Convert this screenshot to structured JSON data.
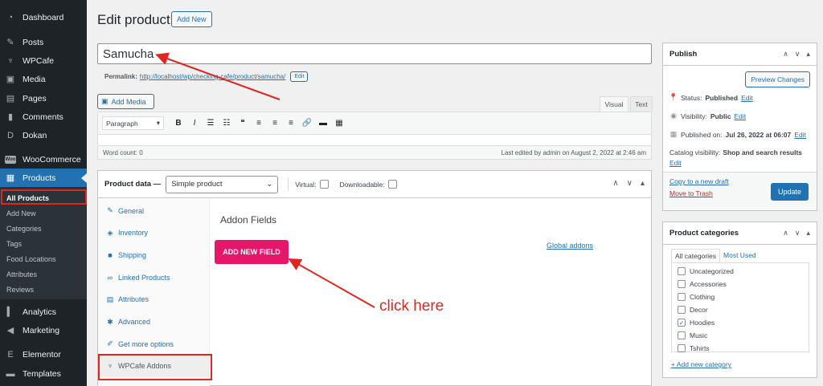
{
  "sidebar": {
    "items": [
      {
        "label": "Dashboard",
        "icon": "dashboard-icon",
        "glyph": "◔"
      },
      {
        "label": "Posts",
        "icon": "pin-icon",
        "glyph": "✎"
      },
      {
        "label": "WPCafe",
        "icon": "cafe-icon",
        "glyph": "♆"
      },
      {
        "label": "Media",
        "icon": "media-icon",
        "glyph": "▣"
      },
      {
        "label": "Pages",
        "icon": "pages-icon",
        "glyph": "▤"
      },
      {
        "label": "Comments",
        "icon": "comment-icon",
        "glyph": "▮"
      },
      {
        "label": "Dokan",
        "icon": "dokan-icon",
        "glyph": "D"
      },
      {
        "label": "WooCommerce",
        "icon": "woocommerce-icon",
        "glyph": "Woo"
      },
      {
        "label": "Products",
        "icon": "products-icon",
        "glyph": "▦"
      },
      {
        "label": "Analytics",
        "icon": "analytics-icon",
        "glyph": "▍"
      },
      {
        "label": "Marketing",
        "icon": "megaphone-icon",
        "glyph": "◀"
      },
      {
        "label": "Elementor",
        "icon": "elementor-icon",
        "glyph": "E"
      },
      {
        "label": "Templates",
        "icon": "folder-icon",
        "glyph": "▬"
      }
    ],
    "submenu": [
      "All Products",
      "Add New",
      "Categories",
      "Tags",
      "Food Locations",
      "Attributes",
      "Reviews"
    ]
  },
  "header": {
    "title": "Edit product",
    "add_new": "Add New"
  },
  "post": {
    "title": "Samucha",
    "permalink_label": "Permalink:",
    "permalink_url": "http://localhost/wp/checking-cafe/product/samucha/",
    "permalink_edit": "Edit"
  },
  "editor": {
    "add_media": "Add Media",
    "tab_visual": "Visual",
    "tab_text": "Text",
    "format": "Paragraph",
    "toolbar": [
      {
        "glyph": "B",
        "icon": "bold-icon"
      },
      {
        "glyph": "I",
        "icon": "italic-icon"
      },
      {
        "glyph": "☰",
        "icon": "bullet-list-icon"
      },
      {
        "glyph": "☷",
        "icon": "numbered-list-icon"
      },
      {
        "glyph": "❝",
        "icon": "blockquote-icon"
      },
      {
        "glyph": "≡",
        "icon": "align-left-icon"
      },
      {
        "glyph": "≡",
        "icon": "align-center-icon"
      },
      {
        "glyph": "≡",
        "icon": "align-right-icon"
      },
      {
        "glyph": "🔗",
        "icon": "link-icon"
      },
      {
        "glyph": "▬",
        "icon": "read-more-icon"
      },
      {
        "glyph": "▦",
        "icon": "toolbar-toggle-icon"
      }
    ],
    "word_count": "Word count: 0",
    "last_edited": "Last edited by admin on August 2, 2022 at 2:46 am"
  },
  "product_data": {
    "title": "Product data —",
    "type": "Simple product",
    "virtual_label": "Virtual:",
    "downloadable_label": "Downloadable:",
    "tabs": [
      {
        "label": "General",
        "icon": "wrench-icon",
        "glyph": "✎"
      },
      {
        "label": "Inventory",
        "icon": "inventory-icon",
        "glyph": "◈"
      },
      {
        "label": "Shipping",
        "icon": "truck-icon",
        "glyph": "■"
      },
      {
        "label": "Linked Products",
        "icon": "link-icon",
        "glyph": "∞"
      },
      {
        "label": "Attributes",
        "icon": "list-icon",
        "glyph": "▤"
      },
      {
        "label": "Advanced",
        "icon": "gear-icon",
        "glyph": "✱"
      },
      {
        "label": "Get more options",
        "icon": "plug-icon",
        "glyph": "✐"
      },
      {
        "label": "WPCafe Addons",
        "icon": "cafe-icon",
        "glyph": "♆"
      }
    ],
    "addon_title": "Addon Fields",
    "add_field_button": "ADD NEW FIELD",
    "global_addons": "Global addons"
  },
  "annotation": {
    "text": "click here",
    "color": "#e0261d"
  },
  "publish": {
    "title": "Publish",
    "preview": "Preview Changes",
    "status_label": "Status:",
    "status_value": "Published",
    "visibility_label": "Visibility:",
    "visibility_value": "Public",
    "published_label": "Published on:",
    "published_value": "Jul 26, 2022 at 06:07",
    "edit": "Edit",
    "catalog_label": "Catalog visibility:",
    "catalog_value": "Shop and search results",
    "copy_draft": "Copy to a new draft",
    "trash": "Move to Trash",
    "update": "Update"
  },
  "categories": {
    "title": "Product categories",
    "tab_all": "All categories",
    "tab_used": "Most Used",
    "items": [
      {
        "label": "Uncategorized",
        "checked": false
      },
      {
        "label": "Accessories",
        "checked": false
      },
      {
        "label": "Clothing",
        "checked": false
      },
      {
        "label": "Decor",
        "checked": false
      },
      {
        "label": "Hoodies",
        "checked": true
      },
      {
        "label": "Music",
        "checked": false
      },
      {
        "label": "Tshirts",
        "checked": false
      }
    ],
    "add_new": "+ Add new category"
  },
  "colors": {
    "accent": "#2271b1",
    "sidebar": "#1d2327",
    "addon_button": "#e6176b",
    "annotation": "#e0261d"
  }
}
